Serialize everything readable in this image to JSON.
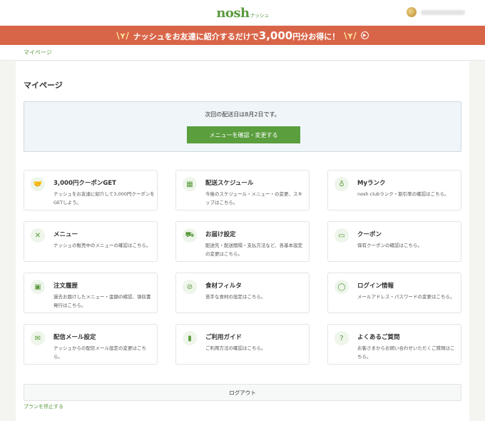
{
  "header": {
    "logo": "nosh",
    "logo_sub": "ナッシュ"
  },
  "banner": {
    "text_before": "ナッシュをお友達に紹介するだけで",
    "amount": "3,000",
    "text_after": "円分お得に！"
  },
  "breadcrumb": "マイページ",
  "page_title": "マイページ",
  "delivery": {
    "date_text": "次回の配送日は8月2日です。",
    "button_label": "メニューを確認・変更する"
  },
  "cards": [
    {
      "icon": "handshake-icon",
      "glyph": "🤝",
      "title": "3,000円クーポンGET",
      "desc": "ナッシュをお友達に紹介して3,000円クーポンをGETしよう。"
    },
    {
      "icon": "calendar-icon",
      "glyph": "▦",
      "title": "配送スケジュール",
      "desc": "今後のスケジュール・メニュー・の変更、スキップはこちら。"
    },
    {
      "icon": "medal-icon",
      "glyph": "♁",
      "title": "Myランク",
      "desc": "nosh clubランク・割引率の確認はこちら。"
    },
    {
      "icon": "utensils-icon",
      "glyph": "✕",
      "title": "メニュー",
      "desc": "ナッシュの販売中のメニューの確認はこちら。"
    },
    {
      "icon": "truck-icon",
      "glyph": "⛟",
      "title": "お届け設定",
      "desc": "配送先・配送間隔・支払方法など、各基本設定の変更はこちら。"
    },
    {
      "icon": "ticket-icon",
      "glyph": "▭",
      "title": "クーポン",
      "desc": "保有クーポンの確認はこちら。"
    },
    {
      "icon": "box-icon",
      "glyph": "▣",
      "title": "注文履歴",
      "desc": "過去お届けしたメニュー・金額の確認、領収書発行はこちら。"
    },
    {
      "icon": "filter-icon",
      "glyph": "⊘",
      "title": "食材フィルタ",
      "desc": "苦手な食材の設定はこちら。"
    },
    {
      "icon": "user-icon",
      "glyph": "◯",
      "title": "ログイン情報",
      "desc": "メールアドレス・パスワードの変更はこちら。"
    },
    {
      "icon": "mail-icon",
      "glyph": "✉",
      "title": "配信メール設定",
      "desc": "ナッシュからの配信メール設定の変更はこちら。"
    },
    {
      "icon": "guide-icon",
      "glyph": "▮",
      "title": "ご利用ガイド",
      "desc": "ご利用方法の確認はこちら。"
    },
    {
      "icon": "question-icon",
      "glyph": "?",
      "title": "よくあるご質問",
      "desc": "お客さまからお問い合わせいただくご質問はこちら。"
    }
  ],
  "logout_label": "ログアウト",
  "stop_plan_label": "プランを停止する"
}
